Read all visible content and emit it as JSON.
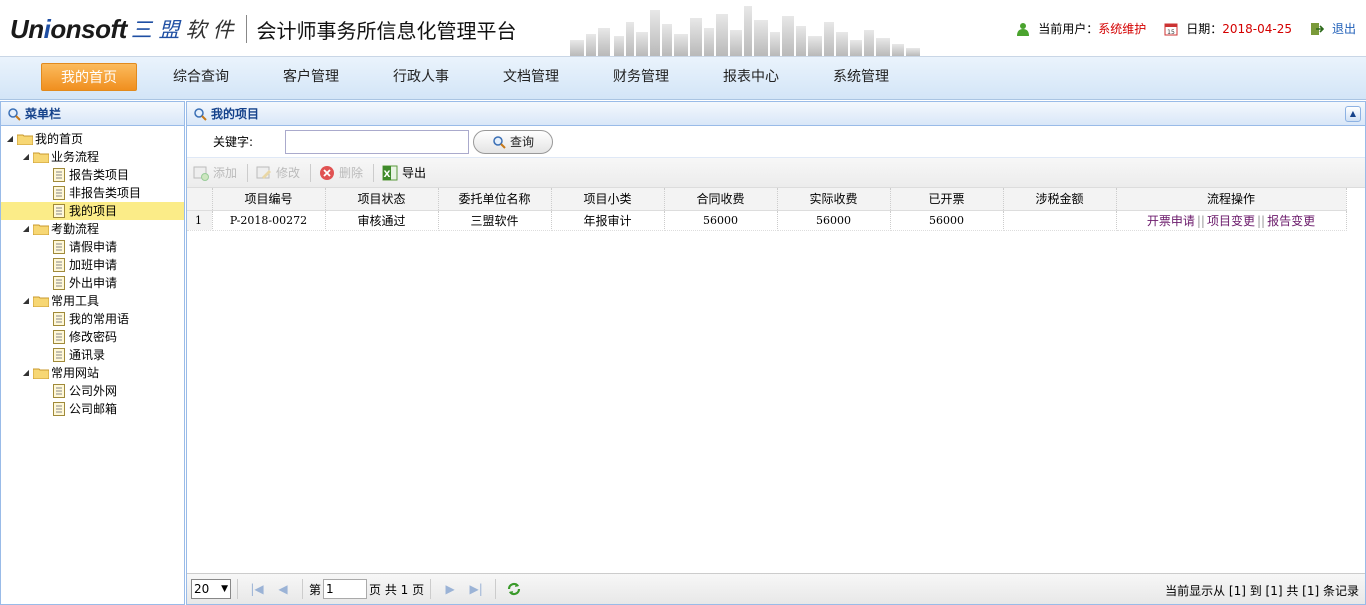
{
  "header": {
    "logo_en_part1": "Un",
    "logo_en_i": "i",
    "logo_en_part2": "onsoft",
    "logo_cn1": "三 盟",
    "logo_cn2": "软件",
    "platform_title": "会计师事务所信息化管理平台",
    "user_label": "当前用户：",
    "user_name": "系统维护",
    "date_label": "日期：",
    "date_value": "2018-04-25",
    "logout": "退出"
  },
  "nav": {
    "items": [
      "我的首页",
      "综合查询",
      "客户管理",
      "行政人事",
      "文档管理",
      "财务管理",
      "报表中心",
      "系统管理"
    ]
  },
  "sidebar": {
    "title": "菜单栏",
    "tree": [
      {
        "label": "我的首页"
      },
      {
        "label": "业务流程"
      },
      {
        "label": "报告类项目"
      },
      {
        "label": "非报告类项目"
      },
      {
        "label": "我的项目"
      },
      {
        "label": "考勤流程"
      },
      {
        "label": "请假申请"
      },
      {
        "label": "加班申请"
      },
      {
        "label": "外出申请"
      },
      {
        "label": "常用工具"
      },
      {
        "label": "我的常用语"
      },
      {
        "label": "修改密码"
      },
      {
        "label": "通讯录"
      },
      {
        "label": "常用网站"
      },
      {
        "label": "公司外网"
      },
      {
        "label": "公司邮箱"
      }
    ]
  },
  "main": {
    "title": "我的项目",
    "search": {
      "label": "关键字:",
      "value": "",
      "button": "查询"
    },
    "toolbar": {
      "add": "添加",
      "edit": "修改",
      "delete": "删除",
      "export": "导出"
    },
    "table": {
      "columns": [
        "项目编号",
        "项目状态",
        "委托单位名称",
        "项目小类",
        "合同收费",
        "实际收费",
        "已开票",
        "涉税金额",
        "流程操作"
      ],
      "rows": [
        {
          "num": "1",
          "code": "P-2018-00272",
          "status": "审核通过",
          "client": "三盟软件",
          "category": "年报审计",
          "contract_fee": "56000",
          "actual_fee": "56000",
          "invoiced": "56000",
          "tax": "",
          "ops": [
            "开票申请",
            "项目变更",
            "报告变更"
          ]
        }
      ]
    },
    "pager": {
      "page_size": "20",
      "page_prefix": "第",
      "page_value": "1",
      "page_suffix": "页 共 1 页",
      "info": "当前显示从 [1] 到 [1] 共 [1] 条记录"
    }
  },
  "colors": {
    "accent_orange": "#f08f1f",
    "nav_bg": "#d3e5f7",
    "panel_title": "#15428b",
    "user_red": "#d40000",
    "link_purple": "#6b1a6b"
  }
}
